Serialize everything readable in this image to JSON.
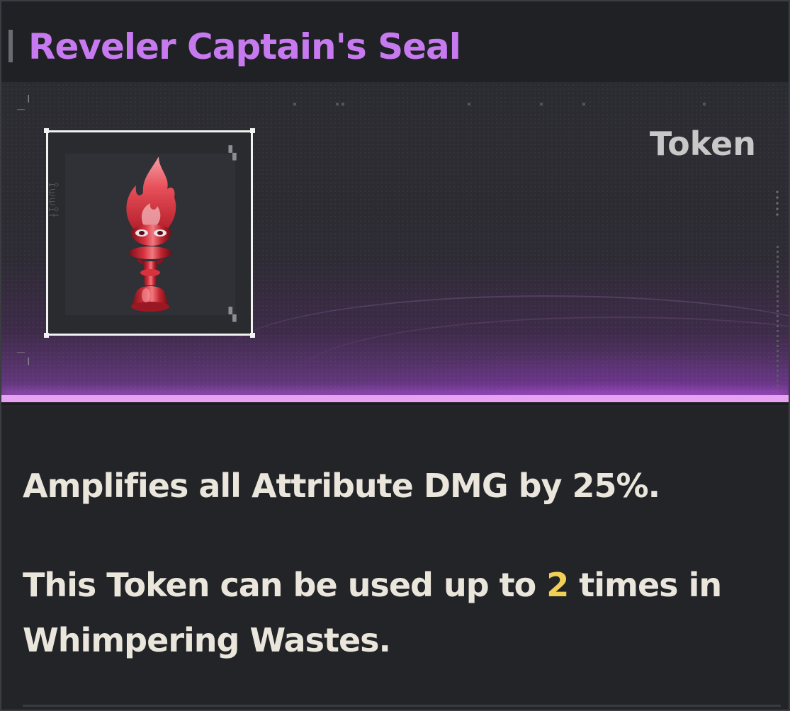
{
  "item": {
    "name": "Reveler Captain's Seal",
    "category": "Token",
    "rarity_color": "#c77af0",
    "icon": "red-flame-torch-icon"
  },
  "description": {
    "line1": "Amplifies all Attribute DMG by 25%.",
    "line2_prefix": "This Token can be used up to ",
    "line2_count": "2",
    "line2_suffix": " times in Whimpering Wastes."
  },
  "colors": {
    "title": "#c77af0",
    "accent_bar": "#e7a3f2",
    "highlight": "#f2cf55",
    "text": "#ebe6dc"
  }
}
